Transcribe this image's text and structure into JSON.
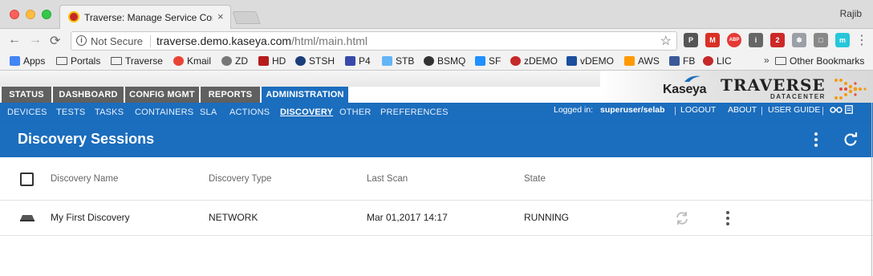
{
  "browser": {
    "tab_title": "Traverse: Manage Service Con",
    "tab_close": "×",
    "profile_name": "Rajib",
    "security_label": "Not Secure",
    "url_host": "traverse.demo.kaseya.com",
    "url_path": "/html/main.html",
    "nav": {
      "back": "←",
      "forward": "→",
      "reload": "⟳"
    },
    "extensions": [
      {
        "name": "pocket-icon",
        "color": "#555555",
        "text": "P"
      },
      {
        "name": "gmail-icon",
        "color": "#d93025",
        "text": "M"
      },
      {
        "name": "adblock-icon",
        "color": "#e53935",
        "text": "ABP"
      },
      {
        "name": "info-extension-icon",
        "color": "#666666",
        "text": "i"
      },
      {
        "name": "lastpass-icon",
        "color": "#cc2929",
        "text": "2"
      },
      {
        "name": "snowflake-icon",
        "color": "#9aa0a6",
        "text": "❄"
      },
      {
        "name": "window-extension-icon",
        "color": "#888888",
        "text": "□"
      },
      {
        "name": "m-extension-icon",
        "color": "#26c6da",
        "text": "m"
      }
    ],
    "menu_icon": "⋮",
    "bookmarks": [
      {
        "label": "Apps",
        "icon": "apps-grid-icon"
      },
      {
        "label": "Portals",
        "icon": "folder-icon"
      },
      {
        "label": "Traverse",
        "icon": "folder-icon"
      },
      {
        "label": "Kmail",
        "icon": "google-icon"
      },
      {
        "label": "ZD",
        "icon": "gear-icon"
      },
      {
        "label": "HD",
        "icon": "hd-icon"
      },
      {
        "label": "STSH",
        "icon": "stsh-icon"
      },
      {
        "label": "P4",
        "icon": "p4-icon"
      },
      {
        "label": "STB",
        "icon": "stb-icon"
      },
      {
        "label": "BSMQ",
        "icon": "smiley-icon"
      },
      {
        "label": "SF",
        "icon": "salesforce-cloud-icon"
      },
      {
        "label": "zDEMO",
        "icon": "traverse-logo-icon"
      },
      {
        "label": "vDEMO",
        "icon": "kaseya-k-icon"
      },
      {
        "label": "AWS",
        "icon": "aws-icon"
      },
      {
        "label": "FB",
        "icon": "facebook-icon"
      },
      {
        "label": "LIC",
        "icon": "traverse-logo-icon"
      }
    ],
    "bookmarks_overflow": "»",
    "other_bookmarks": "Other Bookmarks"
  },
  "app": {
    "main_tabs": [
      "STATUS",
      "DASHBOARD",
      "CONFIG MGMT",
      "REPORTS",
      "ADMINISTRATION"
    ],
    "active_main_tab": "ADMINISTRATION",
    "brand": {
      "kaseya": "Kaseya",
      "traverse": "TRAVERSE",
      "datacenter": "DATACENTER"
    },
    "sub_tabs": [
      "DEVICES",
      "TESTS",
      "TASKS",
      "CONTAINERS",
      "SLA",
      "ACTIONS",
      "DISCOVERY",
      "OTHER",
      "PREFERENCES"
    ],
    "active_sub_tab": "DISCOVERY",
    "logged_in_label": "Logged in:",
    "logged_in_user": "superuser/selab",
    "logout": "LOGOUT",
    "about": "ABOUT",
    "user_guide": "USER GUIDE",
    "separator": "|",
    "accent_color": "#1b6dbd",
    "tab_gray": "#606060"
  },
  "panel": {
    "title": "Discovery Sessions",
    "columns": [
      "Discovery Name",
      "Discovery Type",
      "Last Scan",
      "State"
    ],
    "rows": [
      {
        "name": "My First Discovery",
        "type": "NETWORK",
        "last_scan": "Mar 01,2017 14:17",
        "state": "RUNNING"
      }
    ]
  }
}
